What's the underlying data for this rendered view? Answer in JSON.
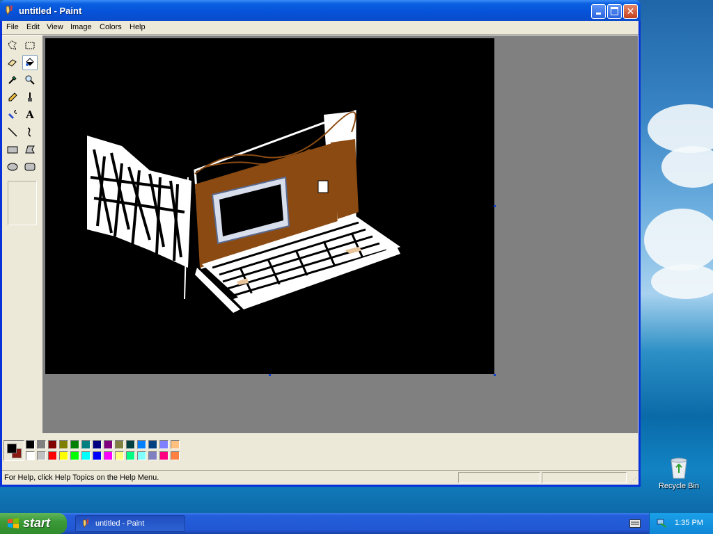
{
  "window": {
    "title": "untitled - Paint"
  },
  "menu": {
    "items": [
      "File",
      "Edit",
      "View",
      "Image",
      "Colors",
      "Help"
    ]
  },
  "palette": {
    "foreground": "#000000",
    "background": "#8b1a10",
    "row1": [
      "#000000",
      "#808080",
      "#800000",
      "#808000",
      "#008000",
      "#008080",
      "#000080",
      "#800080",
      "#808040",
      "#004040",
      "#0080ff",
      "#004080",
      "#8080ff",
      "#ffc080"
    ],
    "row2": [
      "#ffffff",
      "#c0c0c0",
      "#ff0000",
      "#ffff00",
      "#00ff00",
      "#00ffff",
      "#0000ff",
      "#ff00ff",
      "#ffff80",
      "#00ff80",
      "#80ffff",
      "#8080c0",
      "#ff0080",
      "#ff8040"
    ]
  },
  "statusbar": {
    "help_text": "For Help, click Help Topics on the Help Menu."
  },
  "desktop": {
    "recycle_bin_label": "Recycle Bin"
  },
  "taskbar": {
    "start_label": "start",
    "task_label": "untitled - Paint",
    "clock": "1:35 PM"
  }
}
